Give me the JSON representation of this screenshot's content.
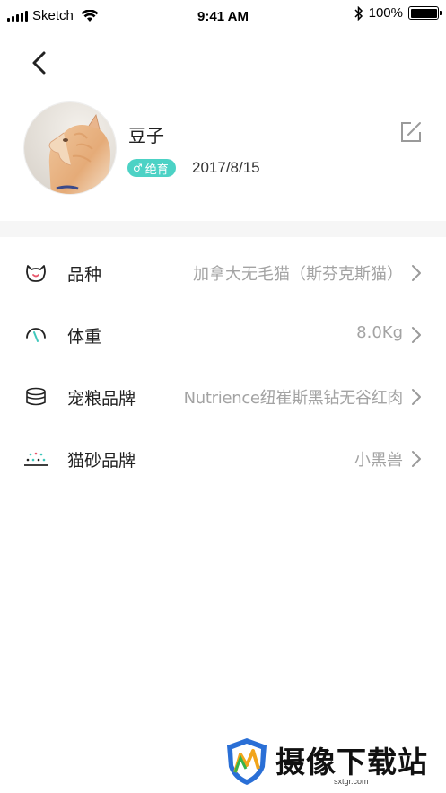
{
  "status_bar": {
    "carrier": "Sketch",
    "time": "9:41 AM",
    "battery": "100%"
  },
  "profile": {
    "name": "豆子",
    "badge_symbol": "♂",
    "badge_text": "绝育",
    "birthday": "2017/8/15"
  },
  "info_rows": [
    {
      "icon": "cat-face-icon",
      "label": "品种",
      "value": "加拿大无毛猫（斯芬克斯猫）"
    },
    {
      "icon": "weight-gauge-icon",
      "label": "体重",
      "value": "8.0Kg"
    },
    {
      "icon": "food-can-icon",
      "label": "宠粮品牌",
      "value": "Nutrience纽崔斯黑钻无谷红肉"
    },
    {
      "icon": "litter-icon",
      "label": "猫砂品牌",
      "value": "小黑兽"
    }
  ],
  "watermark": {
    "title": "摄像下载站",
    "url": "sxtgr.com"
  },
  "colors": {
    "accent": "#4cd2c5",
    "label_gray": "#a3a3a3",
    "cat_icon_pink": "#e8566b"
  }
}
